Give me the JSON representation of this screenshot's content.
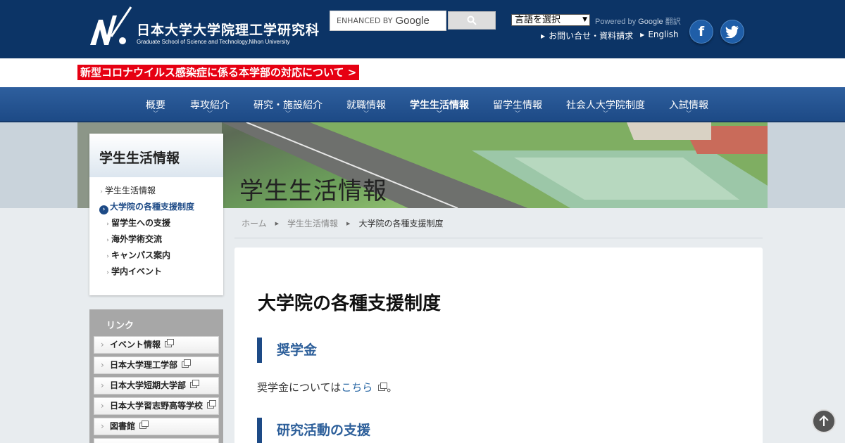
{
  "header": {
    "logo_title": "日本大学大学院理工学研究科",
    "logo_sub": "Graduate School of Science and Technology,Nihon University",
    "search_placeholder_prefix": "ENHANCED BY",
    "search_placeholder_brand": "Google",
    "lang_select_value": "言語を選択",
    "powered_text": "Powered by",
    "powered_brand": "Google",
    "translate_text": "翻訳",
    "util_links": [
      "お問い合せ・資料請求",
      "English"
    ],
    "facebook_glyph": "f",
    "twitter_glyph": "t"
  },
  "notice": "新型コロナウイルス感染症に係る本学部の対応について >",
  "nav": {
    "items": [
      "概要",
      "専攻紹介",
      "研究・施設紹介",
      "就職情報",
      "学生生活情報",
      "留学生情報",
      "社会人大学院制度",
      "入試情報"
    ],
    "active": "学生生活情報"
  },
  "hero": {
    "title": "学生生活情報"
  },
  "side_menu": {
    "title": "学生生活情報",
    "items": [
      "学生生活情報",
      "大学院の各種支援制度",
      "留学生への支援",
      "海外学術交流",
      "キャンパス案内",
      "学内イベント"
    ]
  },
  "links": {
    "title": "リンク",
    "items": [
      "イベント情報",
      "日本大学理工学部",
      "日本大学短期大学部",
      "日本大学習志野高等学校",
      "図書館"
    ]
  },
  "breadcrumb": [
    "ホーム",
    "学生生活情報",
    "大学院の各種支援制度"
  ],
  "main": {
    "title": "大学院の各種支援制度",
    "sections": [
      "奨学金",
      "研究活動の支援"
    ],
    "para_prefix": "奨学金については",
    "para_link": "こちら",
    "para_suffix": "。"
  },
  "colors": {
    "header_bg": "#0c3466",
    "nav_bg": "#1d4a86",
    "notice_bg": "#e60012",
    "accent": "#2d5f9a"
  }
}
